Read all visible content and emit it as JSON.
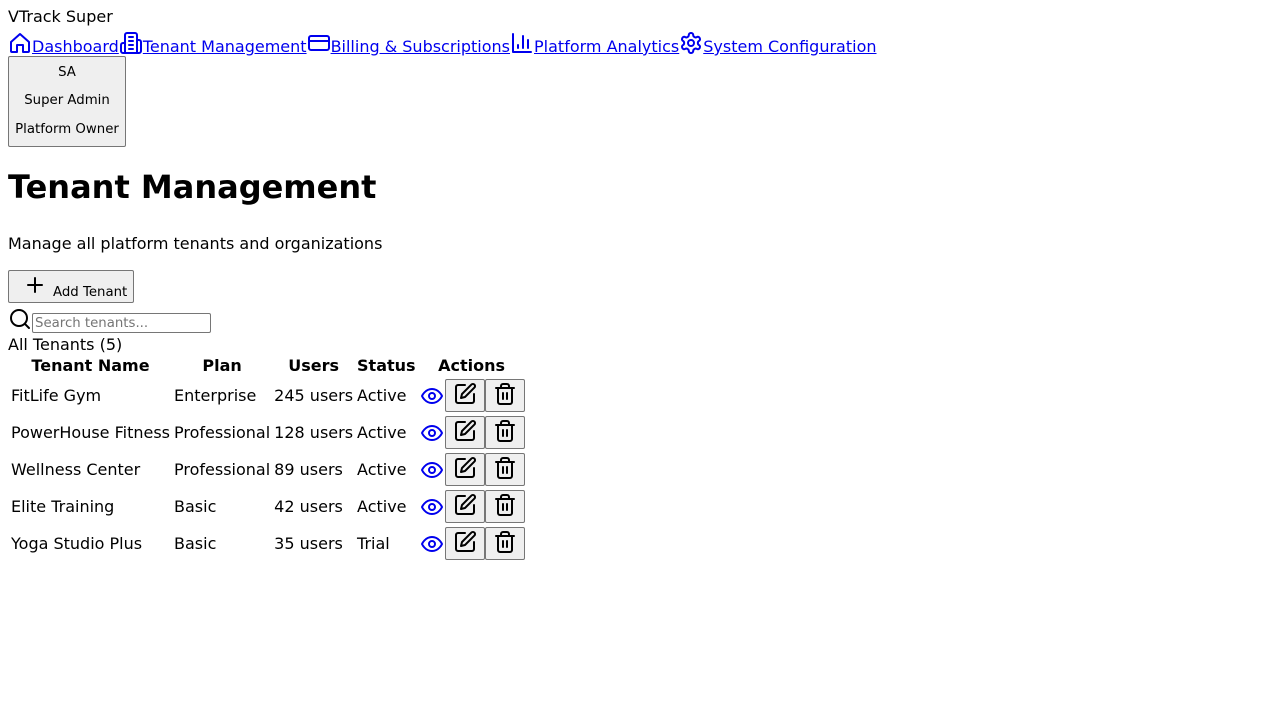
{
  "app": {
    "title": "VTrack Super"
  },
  "nav": {
    "items": [
      {
        "label": "Dashboard",
        "icon": "home-icon"
      },
      {
        "label": "Tenant Management",
        "icon": "building-icon"
      },
      {
        "label": "Billing & Subscriptions",
        "icon": "credit-card-icon"
      },
      {
        "label": "Platform Analytics",
        "icon": "bar-chart-icon"
      },
      {
        "label": "System Configuration",
        "icon": "gear-icon"
      }
    ]
  },
  "user": {
    "initials": "SA",
    "name": "Super Admin",
    "role": "Platform Owner"
  },
  "page": {
    "title": "Tenant Management",
    "subtitle": "Manage all platform tenants and organizations",
    "add_label": "Add Tenant",
    "search_placeholder": "Search tenants..."
  },
  "table": {
    "title": "All Tenants (5)",
    "headers": [
      "Tenant Name",
      "Plan",
      "Users",
      "Status",
      "Actions"
    ],
    "rows": [
      {
        "name": "FitLife Gym",
        "plan": "Enterprise",
        "users": "245 users",
        "status": "Active"
      },
      {
        "name": "PowerHouse Fitness",
        "plan": "Professional",
        "users": "128 users",
        "status": "Active"
      },
      {
        "name": "Wellness Center",
        "plan": "Professional",
        "users": "89 users",
        "status": "Active"
      },
      {
        "name": "Elite Training",
        "plan": "Basic",
        "users": "42 users",
        "status": "Active"
      },
      {
        "name": "Yoga Studio Plus",
        "plan": "Basic",
        "users": "35 users",
        "status": "Trial"
      }
    ]
  },
  "colors": {
    "link": "#0000ee",
    "button_bg": "#efefef",
    "button_border": "#767676"
  }
}
